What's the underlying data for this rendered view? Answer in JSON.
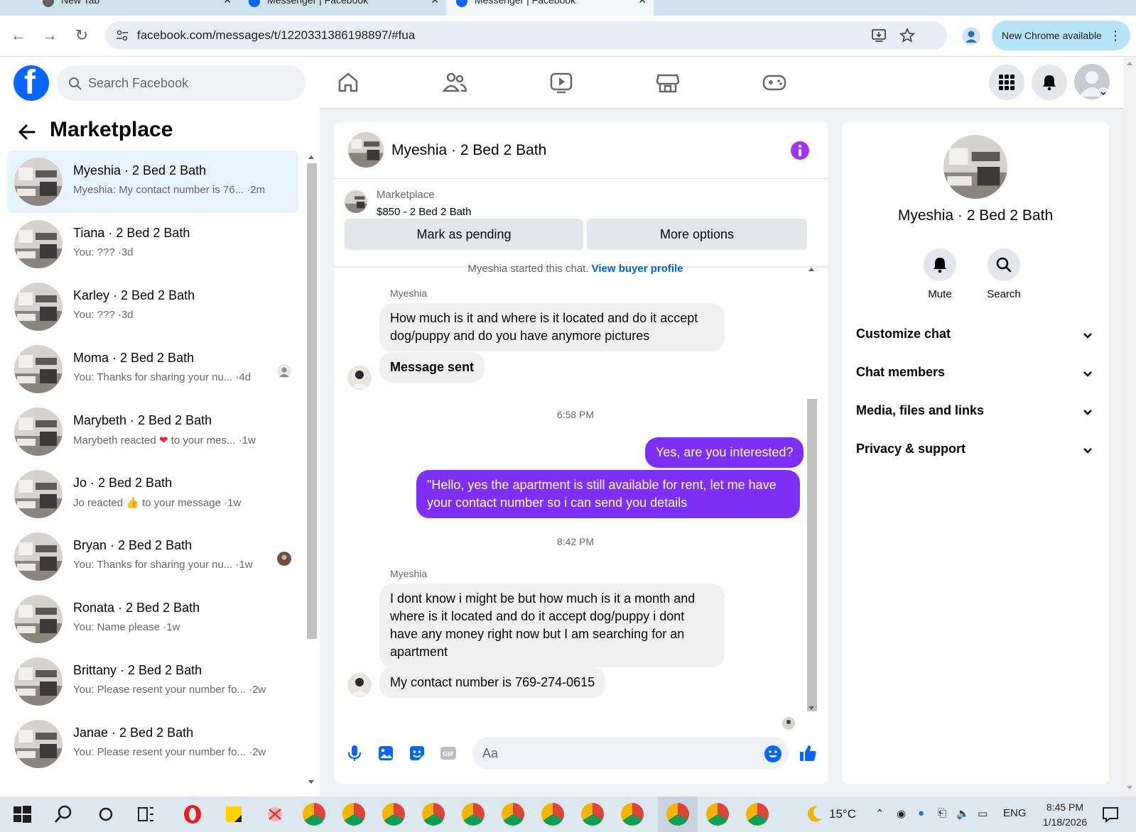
{
  "browser": {
    "tabs": [
      {
        "title": "New Tab",
        "active": false
      },
      {
        "title": "Messenger | Facebook",
        "active": false
      },
      {
        "title": "Messenger | Facebook",
        "active": true
      }
    ],
    "url": "facebook.com/messages/t/1220331386198897/#fua",
    "update_button": "New Chrome available"
  },
  "fb_header": {
    "search_placeholder": "Search Facebook",
    "nav_icons": [
      "home-icon",
      "friends-icon",
      "video-icon",
      "marketplace-icon",
      "gaming-icon"
    ],
    "brand_color": "#0866ff"
  },
  "sidebar": {
    "title": "Marketplace",
    "conversations": [
      {
        "name": "Myeshia · 2 Bed 2 Bath",
        "snippet": "Myeshia: My contact number is 76... ·2m",
        "active": true
      },
      {
        "name": "Tiana · 2 Bed 2 Bath",
        "snippet": "You: ??? ·3d"
      },
      {
        "name": "Karley · 2 Bed 2 Bath",
        "snippet": "You: ??? ·3d"
      },
      {
        "name": "Moma · 2 Bed 2 Bath",
        "snippet": "You: Thanks for sharing your nu... ·4d"
      },
      {
        "name": "Marybeth · 2 Bed 2 Bath",
        "snippet_pre": "Marybeth reacted",
        "snippet_post": "to your mes... ·1w",
        "reaction_icon": "heart-icon"
      },
      {
        "name": "Jo · 2 Bed 2 Bath",
        "snippet_pre": "Jo reacted",
        "snippet_post": "to your message ·1w",
        "reaction_icon": "thumbs-up-icon"
      },
      {
        "name": "Bryan · 2 Bed 2 Bath",
        "snippet": "You: Thanks for sharing your nu... ·1w"
      },
      {
        "name": "Ronata · 2 Bed 2 Bath",
        "snippet": "You: Name please ·1w"
      },
      {
        "name": "Brittany · 2 Bed 2 Bath",
        "snippet": "You: Please resent your number fo... ·2w"
      },
      {
        "name": "Janae · 2 Bed 2 Bath",
        "snippet": "You: Please resent your number fo... ·2w"
      }
    ]
  },
  "chat": {
    "title": "Myeshia · 2 Bed 2 Bath",
    "listing_label": "Marketplace",
    "listing_detail": "$850 - 2 Bed 2 Bath",
    "mark_pending": "Mark as pending",
    "more_options": "More options",
    "start_text": "Myeshia started this chat.",
    "view_profile": "View buyer profile",
    "sender_name": "Myeshia",
    "messages": [
      {
        "from": "them",
        "text": "How much is it and where is it located and do it accept dog/puppy and do you have anymore pictures"
      },
      {
        "from": "them",
        "text": "Message sent"
      },
      {
        "type": "time",
        "text": "6:58 PM"
      },
      {
        "from": "me",
        "text": "Yes, are you interested?"
      },
      {
        "from": "me",
        "text": "\"Hello, yes the apartment is still available for rent, let me have your contact number so i can send you details"
      },
      {
        "type": "time",
        "text": "8:42 PM"
      },
      {
        "from": "them",
        "text": "I dont know i might be but how much is it a month and where is it located and do it accept dog/puppy i dont have any money right now but I am searching for an apartment"
      },
      {
        "from": "them",
        "text": "My contact number is 769-274-0615"
      }
    ],
    "input_placeholder": "Aa",
    "accent_color": "#7b2ff7"
  },
  "details": {
    "title": "Myeshia · 2 Bed 2 Bath",
    "mute": "Mute",
    "search": "Search",
    "sections": [
      "Customize chat",
      "Chat members",
      "Media, files and links",
      "Privacy & support"
    ]
  },
  "taskbar": {
    "temperature": "15°C",
    "language": "ENG",
    "time": "8:45 PM",
    "date": "1/18/2026"
  }
}
